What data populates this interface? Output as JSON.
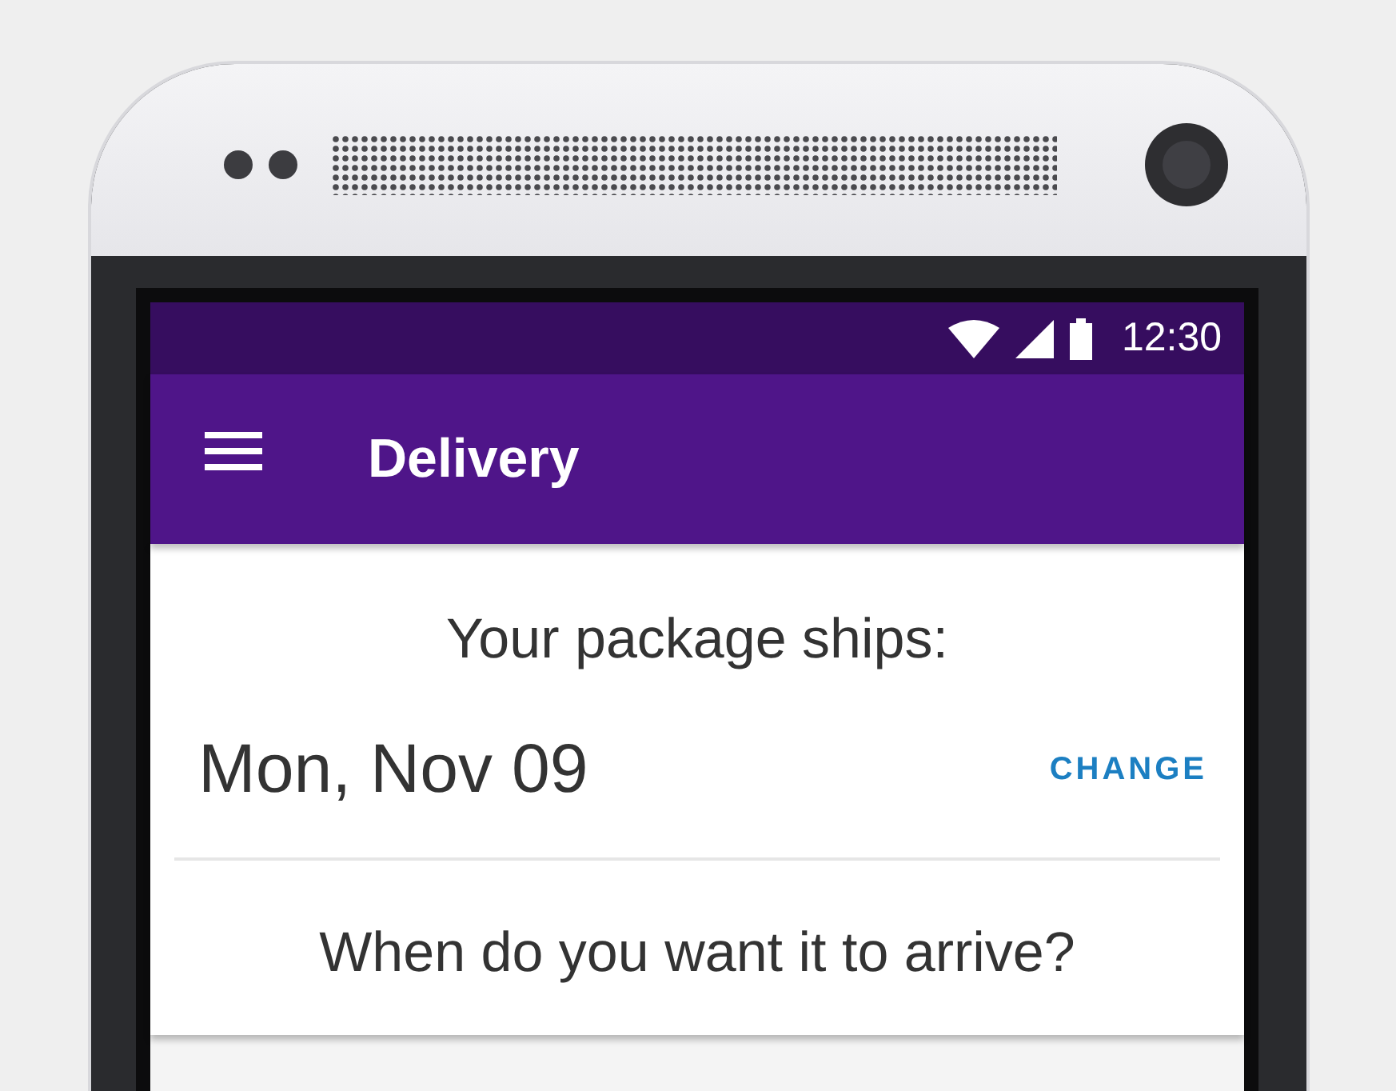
{
  "status_bar": {
    "time": "12:30"
  },
  "app_bar": {
    "title": "Delivery"
  },
  "ship_label": "Your package ships:",
  "ship_date": "Mon, Nov 09",
  "change_button": "CHANGE",
  "question": "When do you want it to arrive?"
}
